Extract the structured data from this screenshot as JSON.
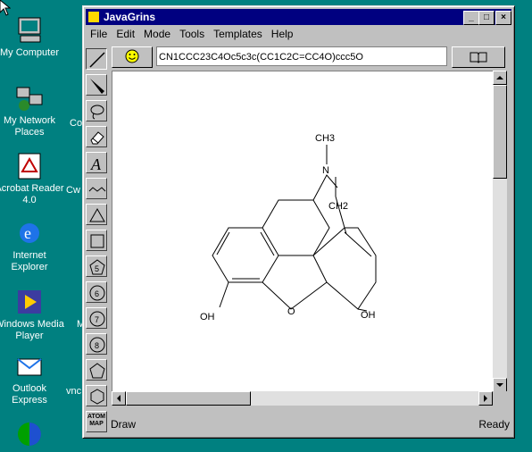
{
  "desktop": {
    "icons": [
      {
        "label": "My Computer"
      },
      {
        "label": "My Network Places"
      },
      {
        "label": "Acrobat Reader 4.0"
      },
      {
        "label": "Internet Explorer"
      },
      {
        "label": "Windows Media Player"
      },
      {
        "label": "Outlook Express"
      }
    ],
    "partial_labels": [
      "Co",
      "Cw",
      "M",
      "vnc"
    ]
  },
  "window": {
    "title": "JavaGrins",
    "controls": {
      "minimize": "_",
      "maximize": "□",
      "close": "×"
    }
  },
  "menu": [
    "File",
    "Edit",
    "Mode",
    "Tools",
    "Templates",
    "Help"
  ],
  "toolbar": {
    "smiles": "CN1CCC23C4Oc5c3c(CC1C2C=CC4O)ccc5O"
  },
  "palette": {
    "tools": [
      "line-tool",
      "wedge-tool",
      "lasso-tool",
      "eraser-tool",
      "text-tool",
      "chain-tool",
      "triangle-tool",
      "square-tool",
      "pentagon-5-tool",
      "ring-6-tool",
      "ring-7-tool",
      "ring-8-tool",
      "pentagon-tool",
      "hexagon-tool"
    ],
    "atom_map_label": "ATOM MAP",
    "ring_labels": [
      "5",
      "6",
      "7",
      "8"
    ]
  },
  "molecule": {
    "labels": {
      "methyl": "CH3",
      "nitrogen": "N",
      "methylene": "CH2",
      "oxygen": "O",
      "hydroxyl_left": "OH",
      "hydroxyl_right": "OH"
    }
  },
  "status": {
    "left": "Draw",
    "right": "Ready"
  }
}
